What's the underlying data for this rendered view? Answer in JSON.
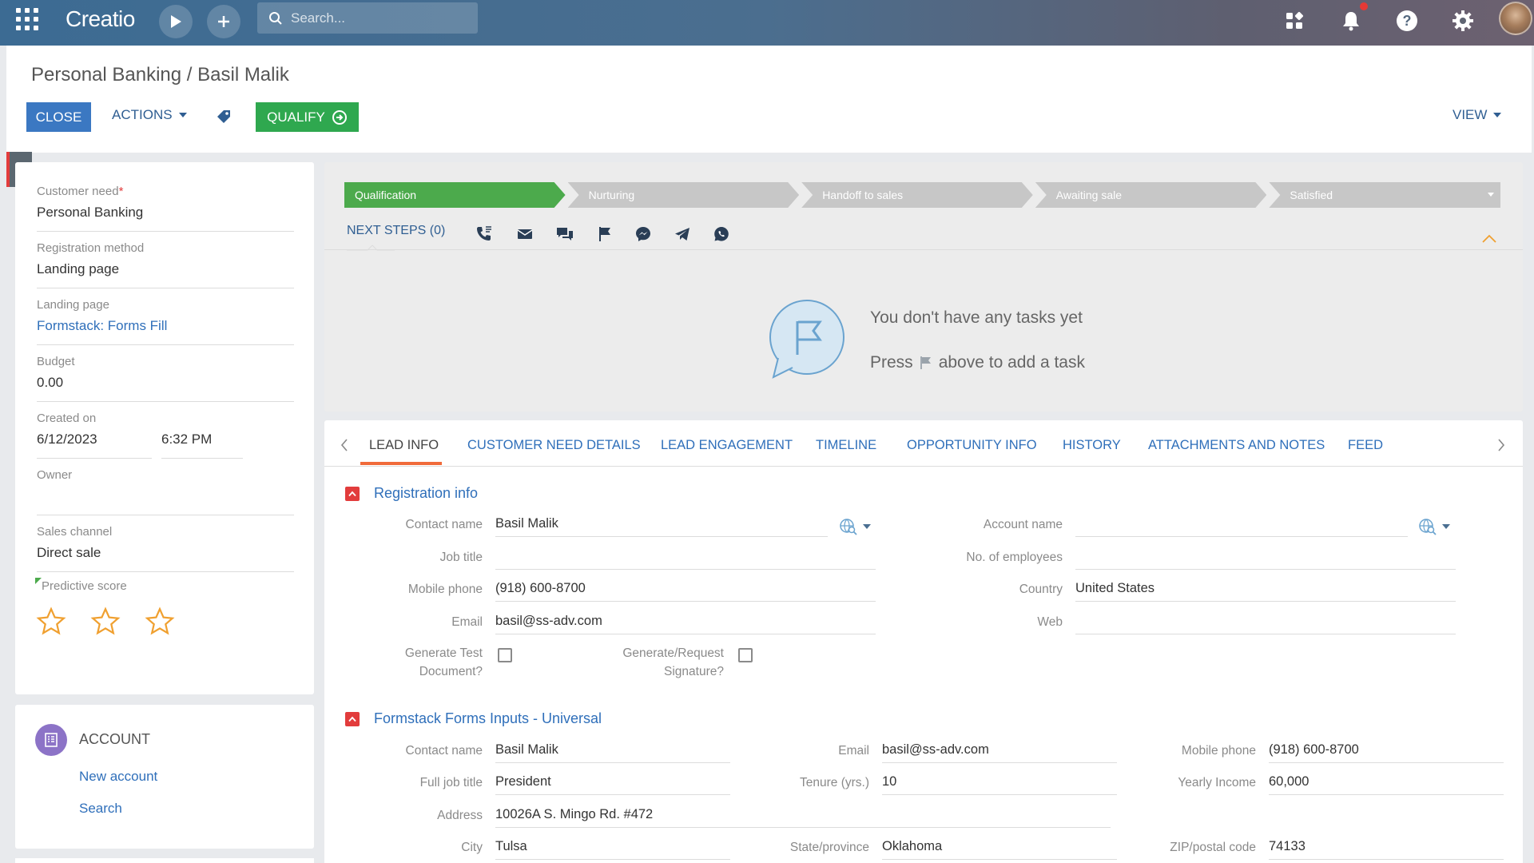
{
  "app": {
    "logo": "Creatio",
    "search_placeholder": "Search..."
  },
  "header": {
    "title": "Personal Banking / Basil Malik",
    "close_label": "CLOSE",
    "actions_label": "ACTIONS",
    "qualify_label": "QUALIFY",
    "view_label": "VIEW"
  },
  "left_panel": {
    "customer_need_label": "Customer need",
    "customer_need_required": "*",
    "customer_need_value": "Personal Banking",
    "registration_method_label": "Registration method",
    "registration_method_value": "Landing page",
    "landing_page_label": "Landing page",
    "landing_page_value": "Formstack: Forms Fill",
    "budget_label": "Budget",
    "budget_value": "0.00",
    "created_on_label": "Created on",
    "created_on_date": "6/12/2023",
    "created_on_time": "6:32 PM",
    "owner_label": "Owner",
    "owner_value": "",
    "sales_channel_label": "Sales channel",
    "sales_channel_value": "Direct sale",
    "predictive_score_label": "Predictive score",
    "predictive_score_stars": 0
  },
  "account": {
    "title": "ACCOUNT",
    "new_account": "New account",
    "search": "Search"
  },
  "stages": [
    {
      "label": "Qualification",
      "active": true
    },
    {
      "label": "Nurturing",
      "active": false
    },
    {
      "label": "Handoff to sales",
      "active": false
    },
    {
      "label": "Awaiting sale",
      "active": false
    },
    {
      "label": "Satisfied",
      "active": false
    }
  ],
  "next_steps": {
    "label": "NEXT STEPS (0)",
    "empty_line1": "You don't have any tasks yet",
    "empty_press": "Press",
    "empty_rest": "above to add a task"
  },
  "tabs": [
    "LEAD INFO",
    "CUSTOMER NEED DETAILS",
    "LEAD ENGAGEMENT",
    "TIMELINE",
    "OPPORTUNITY INFO",
    "HISTORY",
    "ATTACHMENTS AND NOTES",
    "FEED"
  ],
  "registration_info": {
    "title": "Registration info",
    "contact_name_label": "Contact name",
    "contact_name": "Basil Malik",
    "job_title_label": "Job title",
    "job_title": "",
    "mobile_phone_label": "Mobile phone",
    "mobile_phone": "(918) 600-8700",
    "email_label": "Email",
    "email": "basil@ss-adv.com",
    "account_name_label": "Account name",
    "account_name": "",
    "employees_label": "No. of employees",
    "employees": "",
    "country_label": "Country",
    "country": "United States",
    "web_label": "Web",
    "web": "",
    "gen_test_label_1": "Generate Test",
    "gen_test_label_2": "Document?",
    "gen_sig_label_1": "Generate/Request",
    "gen_sig_label_2": "Signature?"
  },
  "formstack": {
    "title": "Formstack Forms Inputs - Universal",
    "contact_name_label": "Contact name",
    "contact_name": "Basil Malik",
    "full_job_title_label": "Full job title",
    "full_job_title": "President",
    "address_label": "Address",
    "address": "10026A S. Mingo Rd. #472",
    "city_label": "City",
    "city": "Tulsa",
    "email_label": "Email",
    "email": "basil@ss-adv.com",
    "tenure_label": "Tenure (yrs.)",
    "tenure": "10",
    "state_label": "State/province",
    "state": "Oklahoma",
    "mobile_phone_label": "Mobile phone",
    "mobile_phone": "(918) 600-8700",
    "yearly_income_label": "Yearly Income",
    "yearly_income": "60,000",
    "zip_label": "ZIP/postal code",
    "zip": "74133"
  },
  "colors": {
    "primary": "#3b78c2",
    "qualify": "#2fa84f",
    "stage_active": "#4caa4c",
    "accent_tab": "#f06a3a",
    "star": "#f0a030"
  }
}
